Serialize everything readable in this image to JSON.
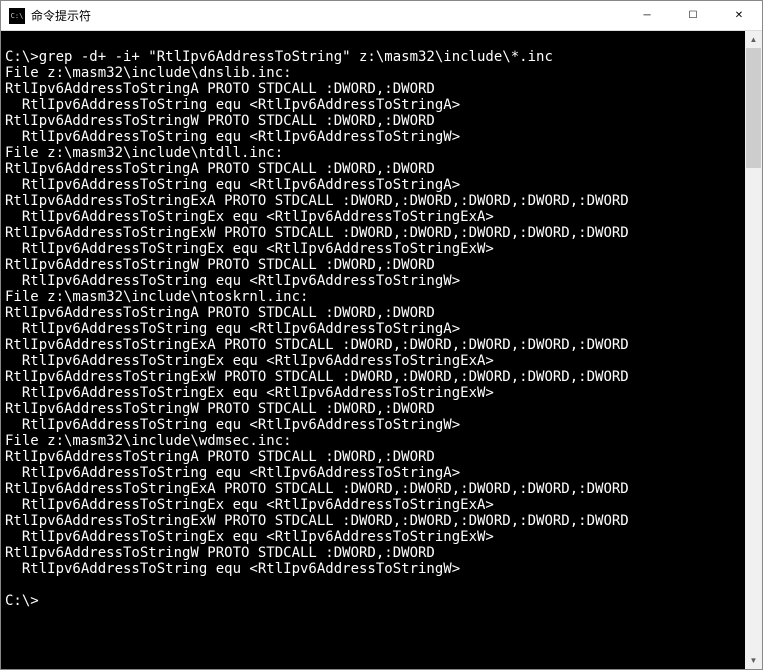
{
  "titlebar": {
    "title": "命令提示符",
    "minimize_icon": "─",
    "maximize_icon": "☐",
    "close_icon": "✕"
  },
  "terminal": {
    "lines": [
      "",
      "C:\\>grep -d+ -i+ \"RtlIpv6AddressToString\" z:\\masm32\\include\\*.inc",
      "File z:\\masm32\\include\\dnslib.inc:",
      "RtlIpv6AddressToStringA PROTO STDCALL :DWORD,:DWORD",
      "  RtlIpv6AddressToString equ <RtlIpv6AddressToStringA>",
      "RtlIpv6AddressToStringW PROTO STDCALL :DWORD,:DWORD",
      "  RtlIpv6AddressToString equ <RtlIpv6AddressToStringW>",
      "File z:\\masm32\\include\\ntdll.inc:",
      "RtlIpv6AddressToStringA PROTO STDCALL :DWORD,:DWORD",
      "  RtlIpv6AddressToString equ <RtlIpv6AddressToStringA>",
      "RtlIpv6AddressToStringExA PROTO STDCALL :DWORD,:DWORD,:DWORD,:DWORD,:DWORD",
      "  RtlIpv6AddressToStringEx equ <RtlIpv6AddressToStringExA>",
      "RtlIpv6AddressToStringExW PROTO STDCALL :DWORD,:DWORD,:DWORD,:DWORD,:DWORD",
      "  RtlIpv6AddressToStringEx equ <RtlIpv6AddressToStringExW>",
      "RtlIpv6AddressToStringW PROTO STDCALL :DWORD,:DWORD",
      "  RtlIpv6AddressToString equ <RtlIpv6AddressToStringW>",
      "File z:\\masm32\\include\\ntoskrnl.inc:",
      "RtlIpv6AddressToStringA PROTO STDCALL :DWORD,:DWORD",
      "  RtlIpv6AddressToString equ <RtlIpv6AddressToStringA>",
      "RtlIpv6AddressToStringExA PROTO STDCALL :DWORD,:DWORD,:DWORD,:DWORD,:DWORD",
      "  RtlIpv6AddressToStringEx equ <RtlIpv6AddressToStringExA>",
      "RtlIpv6AddressToStringExW PROTO STDCALL :DWORD,:DWORD,:DWORD,:DWORD,:DWORD",
      "  RtlIpv6AddressToStringEx equ <RtlIpv6AddressToStringExW>",
      "RtlIpv6AddressToStringW PROTO STDCALL :DWORD,:DWORD",
      "  RtlIpv6AddressToString equ <RtlIpv6AddressToStringW>",
      "File z:\\masm32\\include\\wdmsec.inc:",
      "RtlIpv6AddressToStringA PROTO STDCALL :DWORD,:DWORD",
      "  RtlIpv6AddressToString equ <RtlIpv6AddressToStringA>",
      "RtlIpv6AddressToStringExA PROTO STDCALL :DWORD,:DWORD,:DWORD,:DWORD,:DWORD",
      "  RtlIpv6AddressToStringEx equ <RtlIpv6AddressToStringExA>",
      "RtlIpv6AddressToStringExW PROTO STDCALL :DWORD,:DWORD,:DWORD,:DWORD,:DWORD",
      "  RtlIpv6AddressToStringEx equ <RtlIpv6AddressToStringExW>",
      "RtlIpv6AddressToStringW PROTO STDCALL :DWORD,:DWORD",
      "  RtlIpv6AddressToString equ <RtlIpv6AddressToStringW>",
      "",
      "C:\\>"
    ]
  },
  "scrollbar": {
    "up_arrow": "▲",
    "down_arrow": "▼"
  }
}
